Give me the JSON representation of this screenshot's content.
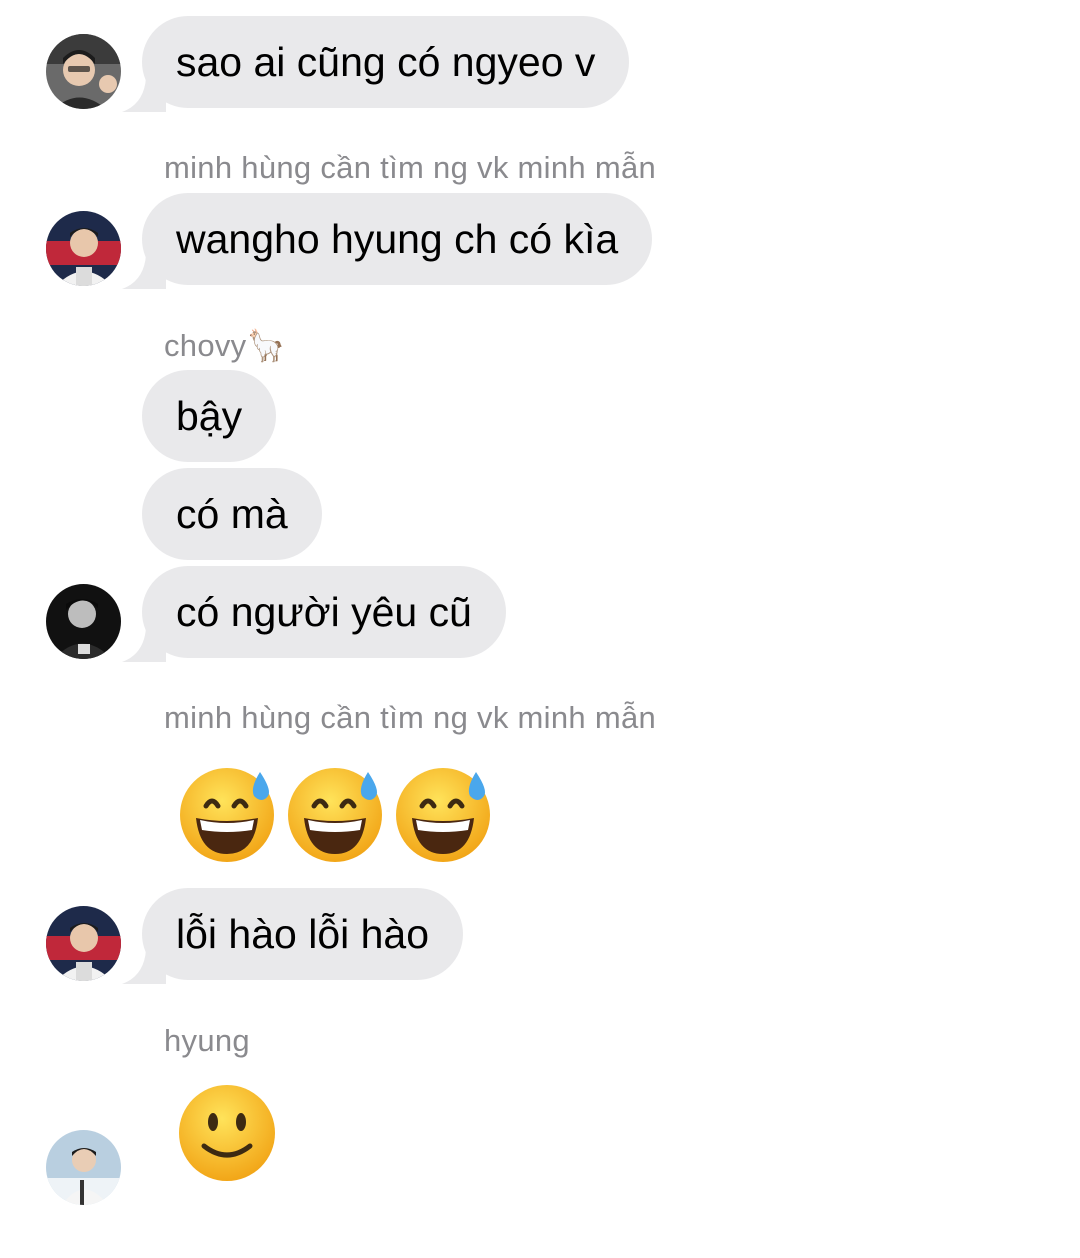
{
  "chat": {
    "messages": [
      {
        "text": "sao ai cũng có ngyeo v"
      },
      {
        "sender": "minh hùng cần tìm ng vk minh mẫn",
        "text": "wangho hyung ch có kìa"
      },
      {
        "sender": "chovy🦙",
        "text": "bậy"
      },
      {
        "text": "có mà"
      },
      {
        "text": "có người yêu cũ"
      },
      {
        "sender": "minh hùng cần tìm ng vk minh mẫn",
        "emoji": "grinning-face-with-sweat x3"
      },
      {
        "text": "lỗi hào lỗi hào"
      },
      {
        "sender": "hyung",
        "emoji": "slightly-smiling-face"
      }
    ]
  },
  "colors": {
    "bubble": "#e9e9eb",
    "sender_name": "#8a8a8e",
    "text": "#000000",
    "background": "#ffffff"
  },
  "icons": {
    "sweat_emoji": "grinning-face-with-sweat",
    "smile_emoji": "slightly-smiling-face"
  }
}
